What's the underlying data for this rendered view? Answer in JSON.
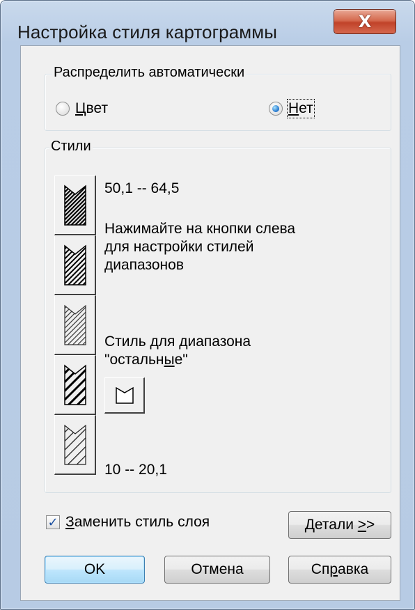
{
  "window": {
    "title": "Настройка стиля картограммы",
    "close_glyph": "X"
  },
  "auto_group": {
    "label": "Распределить автоматически",
    "options": [
      {
        "prefix": "",
        "mnemonic": "Ц",
        "rest": "вет",
        "checked": false
      },
      {
        "prefix": "",
        "mnemonic": "Н",
        "rest": "ет",
        "checked": true
      }
    ]
  },
  "styles_group": {
    "label": "Стили",
    "range_top": "50,1 -- 64,5",
    "hint_lines": [
      "Нажимайте на кнопки слева",
      "для настройки стилей",
      "диапазонов"
    ],
    "other_label_line1": "Стиль для диапазона",
    "other_label_line2_pre": "\"остальн",
    "other_label_line2_mn": "ы",
    "other_label_line2_post": "е\"",
    "range_bottom": "10 -- 20,1",
    "buttons": [
      {
        "icon": "dense-hatch-icon"
      },
      {
        "icon": "medium-hatch-icon"
      },
      {
        "icon": "light-hatch-icon"
      },
      {
        "icon": "wide-hatch-icon"
      },
      {
        "icon": "sparse-hatch-icon"
      }
    ]
  },
  "replace_checkbox": {
    "prefix": "",
    "mnemonic": "З",
    "rest": "аменить стиль слоя",
    "checked": true
  },
  "buttons": {
    "details_pre": "Детали ",
    "details_mn": ">",
    "details_post": ">",
    "ok": "OK",
    "cancel": "Отмена",
    "help_pre": "Сп",
    "help_mn": "р",
    "help_post": "авка"
  },
  "colors": {
    "client_bg": "#f0f0f0",
    "close_red": "#c1432a",
    "default_btn_border": "#3c7fb1"
  }
}
